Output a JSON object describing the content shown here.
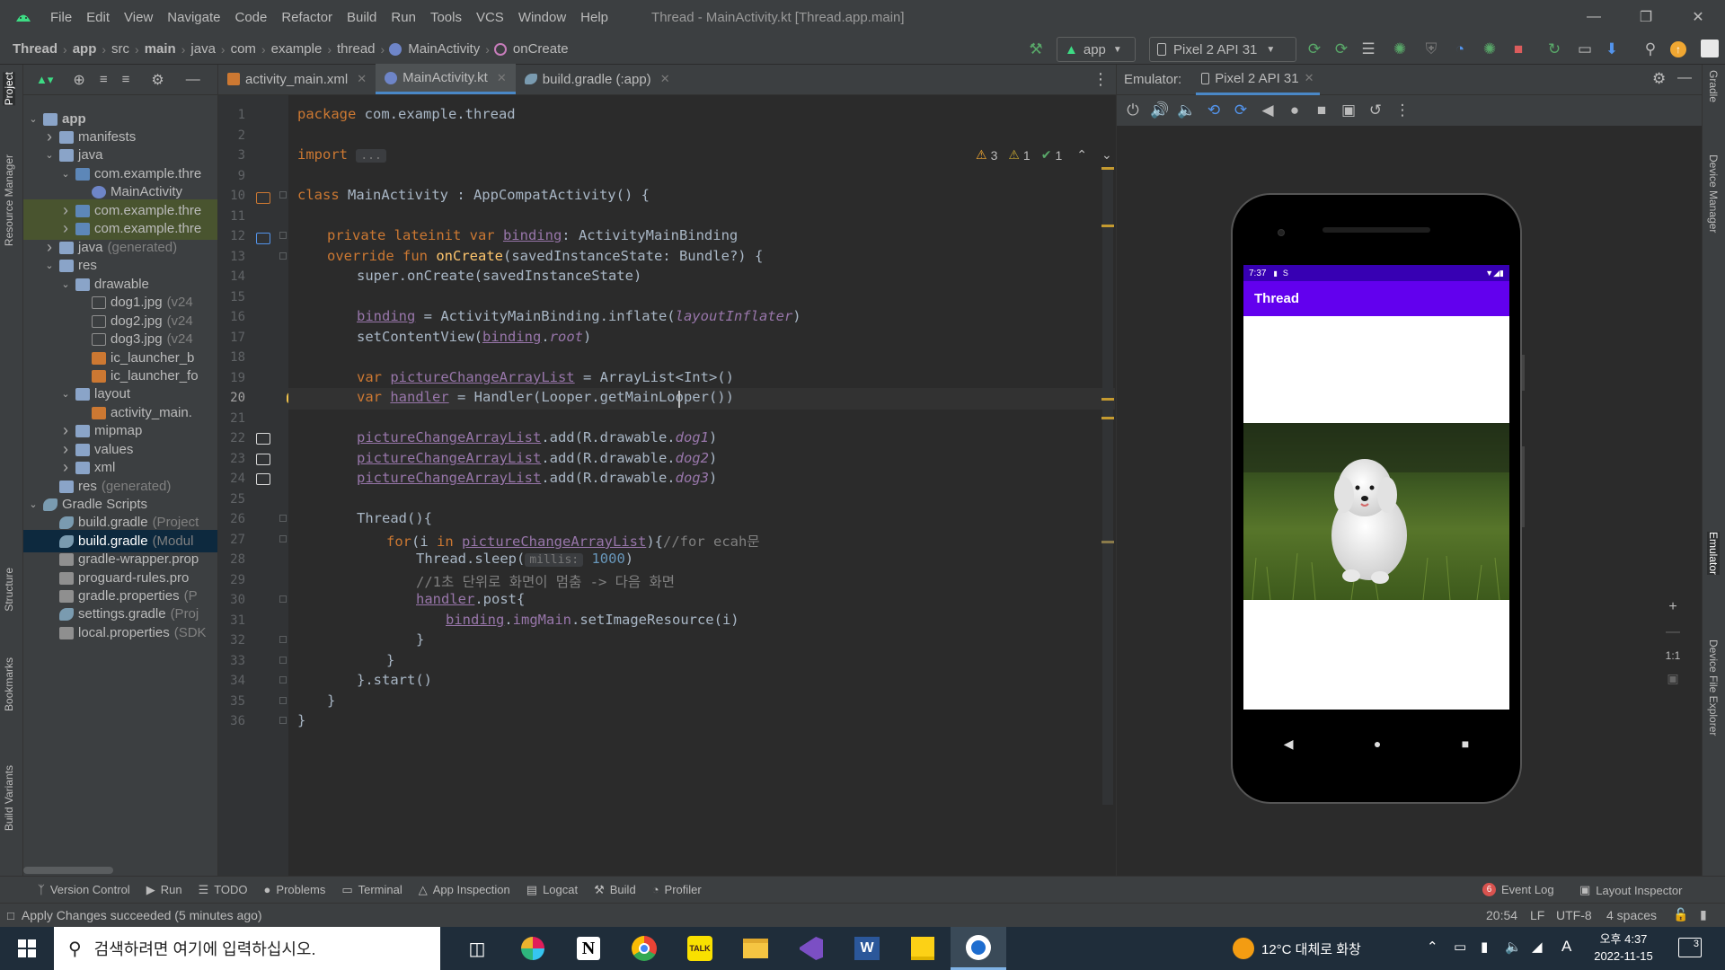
{
  "menu": {
    "items": [
      "File",
      "Edit",
      "View",
      "Navigate",
      "Code",
      "Refactor",
      "Build",
      "Run",
      "Tools",
      "VCS",
      "Window",
      "Help"
    ],
    "title": "Thread - MainActivity.kt [Thread.app.main]"
  },
  "breadcrumb": [
    "Thread",
    "app",
    "src",
    "main",
    "java",
    "com",
    "example",
    "thread",
    "MainActivity",
    "onCreate"
  ],
  "toolbar": {
    "config": "app",
    "device": "Pixel 2 API 31"
  },
  "left_tabs": [
    "Project",
    "Resource Manager",
    "Structure",
    "Bookmarks",
    "Build Variants"
  ],
  "project_tree": [
    {
      "label": "app",
      "depth": 0,
      "arrow": "v",
      "icon": "folder",
      "bold": true
    },
    {
      "label": "manifests",
      "depth": 1,
      "arrow": ">",
      "icon": "folder"
    },
    {
      "label": "java",
      "depth": 1,
      "arrow": "v",
      "icon": "folder"
    },
    {
      "label": "com.example.thre",
      "depth": 2,
      "arrow": "v",
      "icon": "java"
    },
    {
      "label": "MainActivity",
      "depth": 3,
      "arrow": "",
      "icon": "kt"
    },
    {
      "label": "com.example.thre",
      "depth": 2,
      "arrow": ">",
      "icon": "java",
      "hl": true
    },
    {
      "label": "com.example.thre",
      "depth": 2,
      "arrow": ">",
      "icon": "java",
      "hl": true
    },
    {
      "label": "java",
      "extra": "(generated)",
      "depth": 1,
      "arrow": ">",
      "icon": "folder"
    },
    {
      "label": "res",
      "depth": 1,
      "arrow": "v",
      "icon": "folder"
    },
    {
      "label": "drawable",
      "depth": 2,
      "arrow": "v",
      "icon": "folder"
    },
    {
      "label": "dog1.jpg",
      "extra": "(v24",
      "depth": 3,
      "arrow": "",
      "icon": "img"
    },
    {
      "label": "dog2.jpg",
      "extra": "(v24",
      "depth": 3,
      "arrow": "",
      "icon": "img"
    },
    {
      "label": "dog3.jpg",
      "extra": "(v24",
      "depth": 3,
      "arrow": "",
      "icon": "img"
    },
    {
      "label": "ic_launcher_b",
      "depth": 3,
      "arrow": "",
      "icon": "xml"
    },
    {
      "label": "ic_launcher_fo",
      "depth": 3,
      "arrow": "",
      "icon": "xml"
    },
    {
      "label": "layout",
      "depth": 2,
      "arrow": "v",
      "icon": "folder"
    },
    {
      "label": "activity_main.",
      "depth": 3,
      "arrow": "",
      "icon": "xml"
    },
    {
      "label": "mipmap",
      "depth": 2,
      "arrow": ">",
      "icon": "folder"
    },
    {
      "label": "values",
      "depth": 2,
      "arrow": ">",
      "icon": "folder"
    },
    {
      "label": "xml",
      "depth": 2,
      "arrow": ">",
      "icon": "folder"
    },
    {
      "label": "res",
      "extra": "(generated)",
      "depth": 1,
      "arrow": "",
      "icon": "folder"
    },
    {
      "label": "Gradle Scripts",
      "depth": 0,
      "arrow": "v",
      "icon": "gradle"
    },
    {
      "label": "build.gradle",
      "extra": "(Project",
      "depth": 1,
      "arrow": "",
      "icon": "gradle"
    },
    {
      "label": "build.gradle",
      "extra": "(Modul",
      "depth": 1,
      "arrow": "",
      "icon": "gradle",
      "sel": true
    },
    {
      "label": "gradle-wrapper.prop",
      "depth": 1,
      "arrow": "",
      "icon": "file"
    },
    {
      "label": "proguard-rules.pro",
      "depth": 1,
      "arrow": "",
      "icon": "file"
    },
    {
      "label": "gradle.properties",
      "extra": "(P",
      "depth": 1,
      "arrow": "",
      "icon": "file"
    },
    {
      "label": "settings.gradle",
      "extra": "(Proj",
      "depth": 1,
      "arrow": "",
      "icon": "gradle"
    },
    {
      "label": "local.properties",
      "extra": "(SDK",
      "depth": 1,
      "arrow": "",
      "icon": "file"
    }
  ],
  "editor_tabs": [
    "activity_main.xml",
    "MainActivity.kt",
    "build.gradle (:app)"
  ],
  "inspections": {
    "warnings": "3",
    "weak": "1",
    "ok": "1"
  },
  "line_numbers": [
    "1",
    "2",
    "3",
    "9",
    "10",
    "11",
    "12",
    "13",
    "14",
    "15",
    "16",
    "17",
    "18",
    "19",
    "20",
    "21",
    "22",
    "23",
    "24",
    "25",
    "26",
    "27",
    "28",
    "29",
    "30",
    "31",
    "32",
    "33",
    "34",
    "35",
    "36"
  ],
  "code": {
    "l1a": "package",
    "l1b": " com.example.thread",
    "l3a": "import",
    "l3b": "...",
    "l10a": "class",
    "l10b": " MainActivity : AppCompatActivity() {",
    "l12a": "private lateinit var ",
    "l12b": "binding",
    "l12c": ": ActivityMainBinding",
    "l13a": "override fun ",
    "l13b": "onCreate",
    "l13c": "(savedInstanceState: Bundle?) {",
    "l14": "super.onCreate(savedInstanceState)",
    "l16a": "binding",
    "l16b": " = ActivityMainBinding.inflate(",
    "l16c": "layoutInflater",
    "l16d": ")",
    "l17a": "setContentView(",
    "l17b": "binding",
    ".": ".",
    "l17c": "root",
    "l17d": ")",
    "l19a": "var",
    "l19b": " ",
    "l19c": "pictureChangeArrayList",
    "l19d": " = ArrayList<Int>()",
    "l20a": "var",
    "l20b": "handler",
    "l20c": " = Handler(Looper.getMainLooper())",
    "l22a": "pictureChangeArrayList",
    "l22b": ".add(R.drawable.",
    "l22c": "dog1",
    "l22d": ")",
    "l23c": "dog2",
    "l24c": "dog3",
    "l26": "Thread(){",
    "l27a": "for",
    "l27b": "(i ",
    "l27c": "in",
    "l27d": " ",
    "l27e": "pictureChangeArrayList",
    "l27f": "){",
    "l27g": "//for ecah문",
    "l28a": "Thread.sleep(",
    "l28b": "millis:",
    "l28c": "1000",
    "l28d": ")",
    "l29": "//1초 단위로 화면이 멈춤 -> 다음 화면",
    "l30a": "handler",
    "l30b": ".post{",
    "l31a": "binding",
    "l31b": ".",
    "l31c": "imgMain",
    "l31d": ".setImageResource(i)",
    "l32": "}",
    "l33": "}",
    "l34": "}.start()",
    "l35": "}",
    "l36": "}"
  },
  "emulator": {
    "label": "Emulator:",
    "device": "Pixel 2 API 31",
    "status_time": "7:37",
    "app_title": "Thread",
    "zoom": "1:1"
  },
  "right_tabs": [
    "Gradle",
    "Device Manager",
    "Emulator",
    "Device File Explorer"
  ],
  "tool_windows": [
    "Version Control",
    "Run",
    "TODO",
    "Problems",
    "Terminal",
    "App Inspection",
    "Logcat",
    "Build",
    "Profiler"
  ],
  "tool_right": {
    "event_log": "Event Log",
    "event_count": "6",
    "layout_inspector": "Layout Inspector"
  },
  "status": {
    "message": "Apply Changes succeeded (5 minutes ago)",
    "position": "20:54",
    "line_sep": "LF",
    "encoding": "UTF-8",
    "indent": "4 spaces"
  },
  "taskbar": {
    "search_placeholder": "검색하려면 여기에 입력하십시오.",
    "weather": "12°C 대체로 화창",
    "ime": "A",
    "time_ampm": "오후 4:37",
    "date": "2022-11-15",
    "notif": "3"
  },
  "colors": {
    "accent": "#4a88c7",
    "app_bar": "#6200ee",
    "status_bar": "#3700b3"
  }
}
